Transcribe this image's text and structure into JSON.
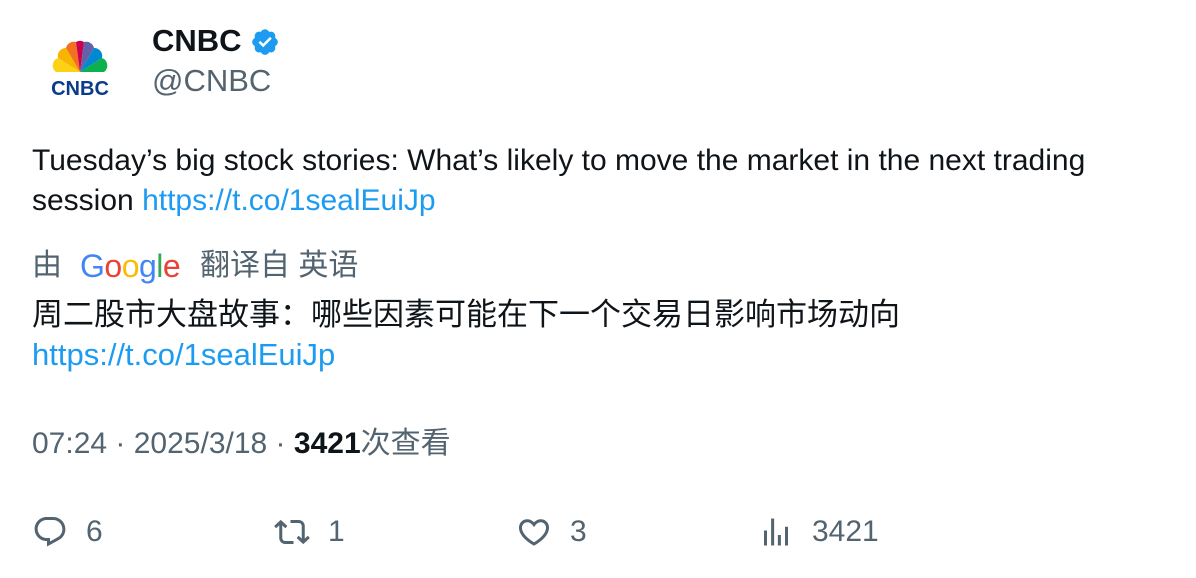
{
  "author": {
    "display_name": "CNBC",
    "handle": "@CNBC",
    "avatar_text": "CNBC"
  },
  "tweet": {
    "text_before_link": "Tuesday’s big stock stories: What’s likely to move the market in the next trading session ",
    "link": "https://t.co/1sealEuiJp"
  },
  "translation": {
    "prefix": "由",
    "provider": "Google",
    "suffix": "翻译自 英语",
    "text": "周二股市大盘故事：哪些因素可能在下一个交易日影响市场动向",
    "link": "https://t.co/1sealEuiJp"
  },
  "meta": {
    "time": "07:24",
    "separator": " · ",
    "date": "2025/3/18",
    "views_count": "3421",
    "views_label": "次查看"
  },
  "actions": {
    "replies": "6",
    "retweets": "1",
    "likes": "3",
    "views": "3421"
  },
  "colors": {
    "link": "#1d9bf0",
    "secondary": "#536471",
    "verified": "#1d9bf0",
    "cnbc_logo": "#0a3a8a"
  }
}
